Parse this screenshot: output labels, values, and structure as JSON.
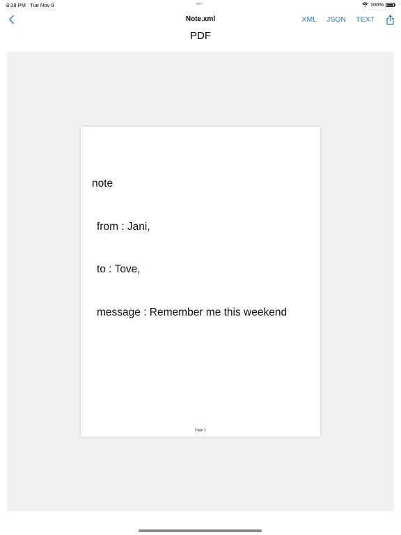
{
  "status_bar": {
    "time": "8:28 PM",
    "date": "Tue Nov 9",
    "battery": "100%",
    "dots": "•••"
  },
  "nav": {
    "title": "Note.xml",
    "actions": [
      "XML",
      "JSON",
      "TEXT"
    ]
  },
  "subtitle": "PDF",
  "document": {
    "lines": [
      "note",
      "from : Jani,",
      "to : Tove,",
      "message : Remember me this weekend"
    ],
    "footer": "Page 1"
  },
  "colors": {
    "accent": "#2f7cc9",
    "viewer_bg": "#f1f1f5"
  }
}
